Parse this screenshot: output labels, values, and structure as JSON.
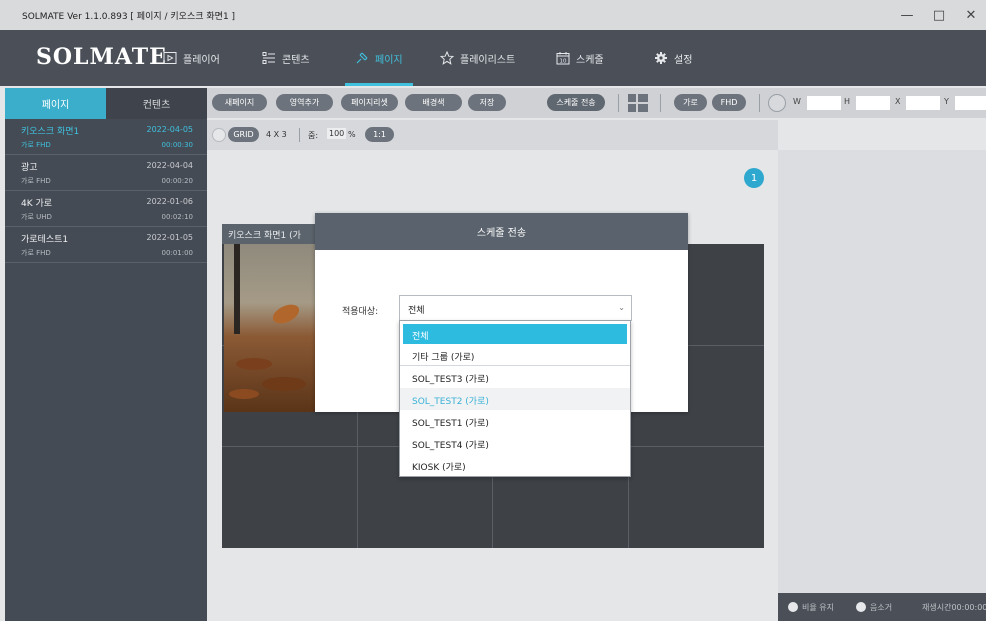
{
  "window": {
    "title": "SOLMATE Ver 1.1.0.893  [ 페이지 / 키오스크 화면1 ]",
    "min": "—",
    "max": "□",
    "close": "✕"
  },
  "logo": "SOLMATE",
  "nav": {
    "items": [
      {
        "label": "플레이어",
        "icon": "play-icon"
      },
      {
        "label": "콘텐츠",
        "icon": "list-icon"
      },
      {
        "label": "페이지",
        "icon": "pin-icon"
      },
      {
        "label": "플레이리스트",
        "icon": "star-icon"
      },
      {
        "label": "스케줄",
        "icon": "calendar-icon",
        "icon_text": "10"
      },
      {
        "label": "설정",
        "icon": "gear-icon"
      }
    ],
    "active": "페이지"
  },
  "left": {
    "tabs": [
      "페이지",
      "컨텐츠"
    ],
    "items": [
      {
        "name": "키오스크 화면1",
        "date": "2022-04-05",
        "meta": "가로  FHD",
        "duration": "00:00:30"
      },
      {
        "name": "광고",
        "date": "2022-04-04",
        "meta": "가로  FHD",
        "duration": "00:00:20"
      },
      {
        "name": "4K 가로",
        "date": "2022-01-06",
        "meta": "가로  UHD",
        "duration": "00:02:10"
      },
      {
        "name": "가로테스트1",
        "date": "2022-01-05",
        "meta": "가로  FHD",
        "duration": "00:01:00"
      }
    ]
  },
  "toolbar": {
    "new_page": "새페이지",
    "add_area": "영역추가",
    "page_preset": "페이지리셋",
    "bg_color": "배경색",
    "save": "저장",
    "send_schedule": "스케줄 전송",
    "orientation": "가로",
    "resolution": "FHD",
    "w_label": "W",
    "h_label": "H",
    "x_label": "X",
    "y_label": "Y"
  },
  "toolbar2": {
    "grid": "GRID",
    "grid_size": "4 X 3",
    "zoom_label": "줌:",
    "zoom_value": "100",
    "zoom_unit": "%",
    "ratio": "1:1"
  },
  "canvas": {
    "badge": "1",
    "page_title": "키오스크 화면1 (가"
  },
  "right": {
    "keep_ratio": "비율 유지",
    "mute": "음소거",
    "play_time": "재생시간00:00:00"
  },
  "modal": {
    "title": "스케줄 전송",
    "apply_label": "적용대상:",
    "selected": "전체",
    "options": [
      "전체",
      "기타 그룹 (가로)",
      "SOL_TEST3 (가로)",
      "SOL_TEST2 (가로)",
      "SOL_TEST1 (가로)",
      "SOL_TEST4 (가로)",
      "KIOSK (가로)"
    ],
    "hover_option": "SOL_TEST2 (가로)"
  },
  "colors": {
    "accent": "#3fc0dd",
    "nav_bg": "#4b5058",
    "panel_bg": "#454b54",
    "modal_head": "#5a636d",
    "highlight": "#2dbbe0"
  }
}
